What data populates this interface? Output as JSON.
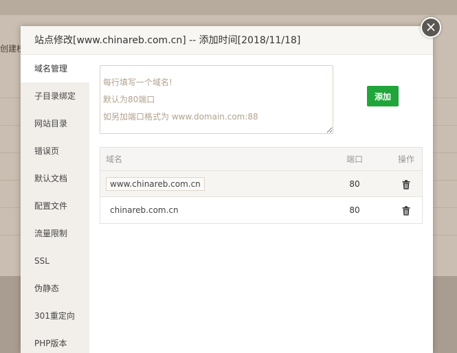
{
  "background": {
    "left_text": "创建校"
  },
  "modal": {
    "title": "站点修改[www.chinareb.com.cn] -- 添加时间[2018/11/18]",
    "close_icon": "close-icon"
  },
  "sidebar": {
    "items": [
      {
        "label": "域名管理",
        "active": true
      },
      {
        "label": "子目录绑定"
      },
      {
        "label": "网站目录"
      },
      {
        "label": "错误页"
      },
      {
        "label": "默认文档"
      },
      {
        "label": "配置文件"
      },
      {
        "label": "流量限制"
      },
      {
        "label": "SSL"
      },
      {
        "label": "伪静态"
      },
      {
        "label": "301重定向"
      },
      {
        "label": "PHP版本"
      }
    ]
  },
  "domain_input": {
    "hint_lines": [
      "每行填写一个域名!",
      "默认为80端口",
      "如另加端口格式为 www.domain.com:88"
    ]
  },
  "add_button": {
    "label": "添加",
    "color": "#20a53a"
  },
  "domain_table": {
    "headers": [
      "域名",
      "端口",
      "操作"
    ],
    "rows": [
      {
        "domain": "www.chinareb.com.cn",
        "port": "80",
        "action_icon": "trash-icon"
      },
      {
        "domain": "chinareb.com.cn",
        "port": "80",
        "action_icon": "trash-icon"
      }
    ]
  }
}
